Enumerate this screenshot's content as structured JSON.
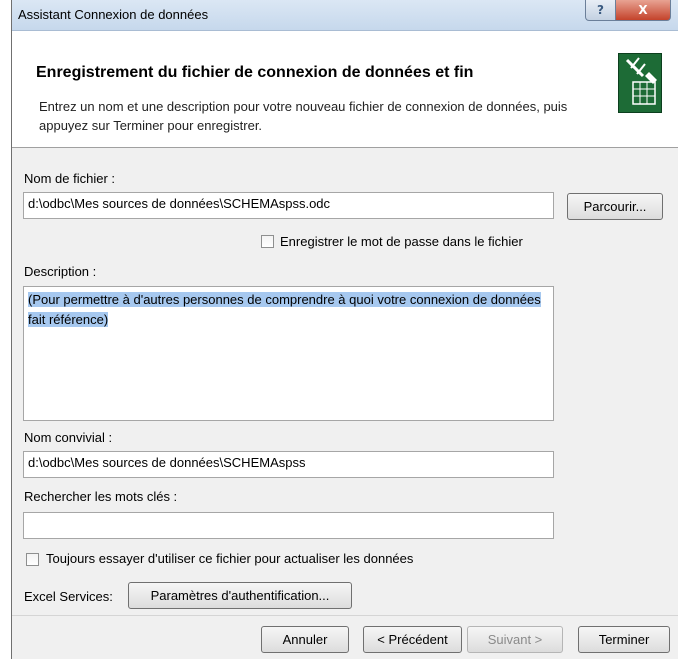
{
  "window": {
    "title": "Assistant Connexion de données",
    "help_glyph": "?",
    "close_glyph": "X"
  },
  "header": {
    "title": "Enregistrement du fichier de connexion de données et fin",
    "description": "Entrez un nom et une description pour votre nouveau fichier de connexion de données, puis appuyez sur Terminer pour enregistrer.",
    "icon": "data-connection-wizard-icon"
  },
  "file": {
    "label": "Nom de fichier :",
    "value": "d:\\odbc\\Mes sources de données\\SCHEMAspss.odc",
    "browse_label": "Parcourir..."
  },
  "save_password": {
    "label": "Enregistrer le mot de passe dans le fichier",
    "checked": false
  },
  "description": {
    "label": "Description :",
    "value": "(Pour permettre à d'autres personnes de comprendre à quoi votre connexion de données fait référence)"
  },
  "friendly_name": {
    "label": "Nom convivial :",
    "value": "d:\\odbc\\Mes sources de données\\SCHEMAspss"
  },
  "keywords": {
    "label": "Rechercher les mots clés :",
    "value": ""
  },
  "always_use": {
    "label": "Toujours essayer d'utiliser ce fichier pour actualiser les données",
    "checked": false
  },
  "excel_services": {
    "label": "Excel Services:",
    "auth_button": "Paramètres d'authentification..."
  },
  "buttons": {
    "cancel": "Annuler",
    "previous": "< Précédent",
    "next": "Suivant >",
    "finish": "Terminer"
  }
}
